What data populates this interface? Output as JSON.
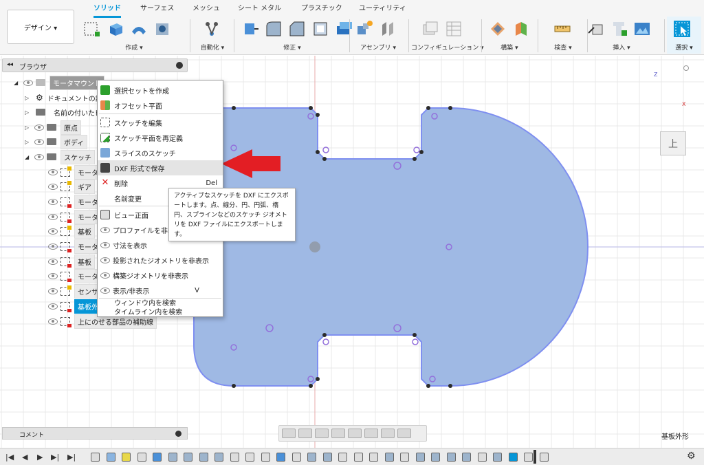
{
  "ribbon": {
    "design_label": "デザイン ▾",
    "tabs": [
      "ソリッド",
      "サーフェス",
      "メッシュ",
      "シート メタル",
      "プラスチック",
      "ユーティリティ"
    ],
    "groups": {
      "create": "作成 ▾",
      "automate": "自動化 ▾",
      "modify": "修正 ▾",
      "assemble": "アセンブリ ▾",
      "configure": "コンフィギュレーション ▾",
      "construct": "構築 ▾",
      "inspect": "検査 ▾",
      "insert": "挿入 ▾",
      "select": "選択 ▾"
    }
  },
  "browser": {
    "title": "ブラウザ",
    "root": "モータマウント",
    "items": [
      "ドキュメントの設",
      "名前の付いたビ",
      "原点",
      "ボディ",
      "スケッチ"
    ],
    "sketches": [
      "モータ",
      "ギア",
      "モータ",
      "モータ",
      "基板",
      "モータ",
      "基板",
      "モータ",
      "センサ",
      "基板外形",
      "上にのせる部品の補助線"
    ]
  },
  "context_menu": {
    "items": [
      {
        "label": "選択セットを作成",
        "shortcut": ""
      },
      {
        "label": "オフセット平面",
        "shortcut": ""
      },
      {
        "label": "スケッチを編集",
        "shortcut": ""
      },
      {
        "label": "スケッチ平面を再定義",
        "shortcut": ""
      },
      {
        "label": "スライスのスケッチ",
        "shortcut": ""
      },
      {
        "label": "DXF 形式で保存",
        "shortcut": ""
      },
      {
        "label": "削除",
        "shortcut": "Del"
      },
      {
        "label": "名前変更",
        "shortcut": ""
      },
      {
        "label": "ビュー正面",
        "shortcut": ""
      },
      {
        "label": "プロファイルを非表示",
        "shortcut": ""
      },
      {
        "label": "寸法を表示",
        "shortcut": ""
      },
      {
        "label": "投影されたジオメトリを非表示",
        "shortcut": ""
      },
      {
        "label": "構築ジオメトリを非表示",
        "shortcut": ""
      },
      {
        "label": "表示/非表示",
        "shortcut": "V"
      },
      {
        "label": "ウィンドウ内を検索",
        "shortcut": ""
      },
      {
        "label": "タイムライン内を検索",
        "shortcut": ""
      }
    ]
  },
  "tooltip": {
    "text": "アクティブなスケッチを DXF にエクスポートします。点、線分、円、円弧、楕円、スプラインなどのスケッチ ジオメトリを DXF ファイルにエクスポートします。"
  },
  "comment": {
    "title": "コメント"
  },
  "status": {
    "active_sketch": "基板外形"
  },
  "viewcube": {
    "z": "Z",
    "x": "X",
    "face": "上"
  },
  "colors": {
    "accent": "#0696d7",
    "profile_fill": "#9fb9e4",
    "profile_stroke": "#7f8ff0",
    "arrow": "#e31e24"
  }
}
